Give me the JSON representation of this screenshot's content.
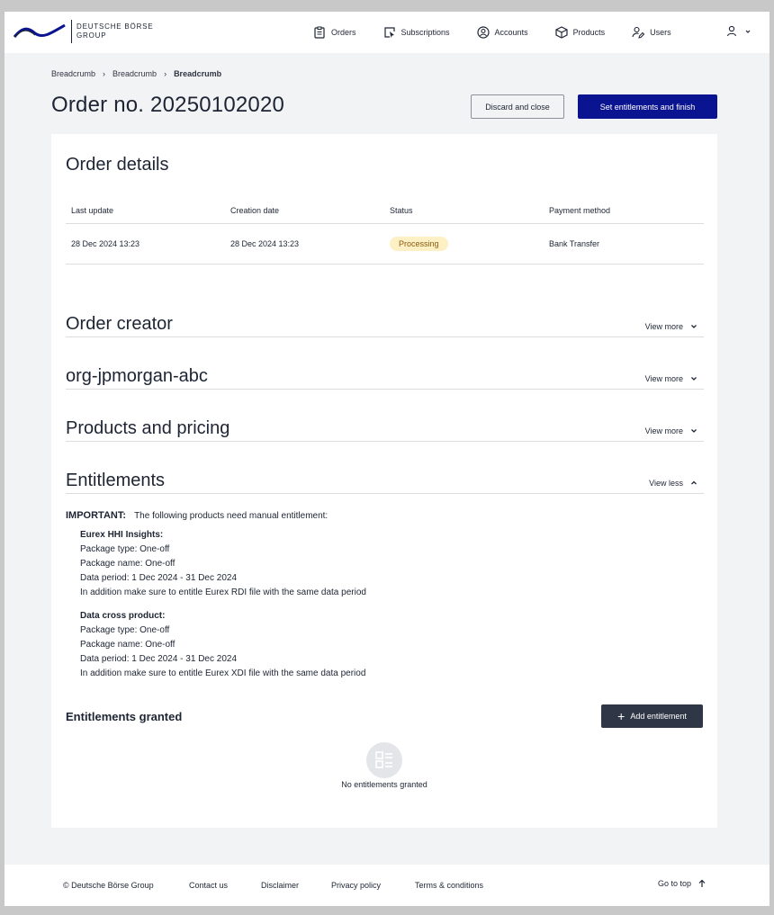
{
  "brand": {
    "line1": "DEUTSCHE BÖRSE",
    "line2": "GROUP"
  },
  "nav": {
    "items": [
      {
        "label": "Orders",
        "icon": "clipboard-icon"
      },
      {
        "label": "Subscriptions",
        "icon": "cursor-window-icon"
      },
      {
        "label": "Accounts",
        "icon": "account-circle-icon"
      },
      {
        "label": "Products",
        "icon": "box-icon"
      },
      {
        "label": "Users",
        "icon": "user-edit-icon"
      }
    ],
    "user_icon": "user-icon"
  },
  "breadcrumb": [
    "Breadcrumb",
    "Breadcrumb",
    "Breadcrumb"
  ],
  "page": {
    "title": "Order no. 20250102020",
    "discard_label": "Discard and close",
    "finish_label": "Set entitlements and finish"
  },
  "order_details": {
    "title": "Order details",
    "headers": [
      "Last update",
      "Creation date",
      "Status",
      "Payment method"
    ],
    "row": {
      "last_update": "28 Dec 2024  13:23",
      "creation_date": "28 Dec 2024  13:23",
      "status": "Processing",
      "payment": "Bank Transfer"
    }
  },
  "sections": [
    {
      "title": "Order creator",
      "toggle": "View more"
    },
    {
      "title": "org-jpmorgan-abc",
      "toggle": "View more"
    },
    {
      "title": "Products and pricing",
      "toggle": "View more"
    },
    {
      "title": "Entitlements",
      "toggle": "View less"
    }
  ],
  "entitlements": {
    "important_label": "IMPORTANT:",
    "important_text": "The following products need manual entitlement:",
    "products": [
      {
        "name": "Eurex HHI Insights:",
        "package_type": "Package type: One-off",
        "package_name": "Package name: One-off",
        "data_period": "Data period: 1 Dec 2024 - 31 Dec 2024",
        "note": "In addition make sure to entitle Eurex RDI file with the same data period"
      },
      {
        "name": "Data cross product:",
        "package_type": "Package type: One-off",
        "package_name": "Package name: One-off",
        "data_period": "Data period: 1 Dec 2024 - 31 Dec 2024",
        "note": "In addition make sure to entitle Eurex XDI file with the same data period"
      }
    ],
    "granted_title": "Entitlements granted",
    "add_label": "Add entitlement",
    "empty_text": "No entitlements granted"
  },
  "footer": {
    "copyright": "© Deutsche Börse Group",
    "contact": "Contact us",
    "disclaimer": "Disclaimer",
    "privacy": "Privacy policy",
    "terms": "Terms & conditions",
    "gotop": "Go to top"
  },
  "colors": {
    "primary": "#0b1490",
    "dark_button": "#2f3645",
    "badge_bg": "#fdf0c4",
    "page_bg": "#f2f3f5"
  }
}
